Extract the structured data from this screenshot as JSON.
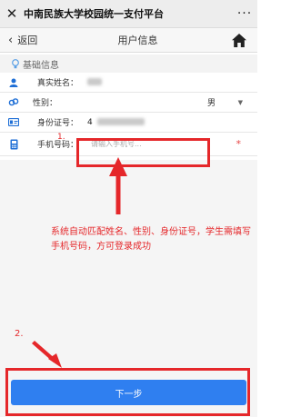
{
  "titlebar": {
    "close_icon": "close-x-icon",
    "title": "中南民族大学校园统一支付平台",
    "more_icon": "more-dots-icon",
    "more": "···"
  },
  "navbar": {
    "back_label": "返回",
    "title": "用户信息",
    "home_icon": "home-icon"
  },
  "section": {
    "title": "基础信息",
    "icon": "lightbulb-icon"
  },
  "form": {
    "name": {
      "label": "真实姓名：",
      "icon": "user-icon"
    },
    "gender": {
      "label": "性别：",
      "value": "男",
      "icon": "gender-icon"
    },
    "id_number": {
      "label": "身份证号：",
      "value_prefix": "4",
      "icon": "id-card-icon"
    },
    "phone": {
      "label": "手机号码：",
      "placeholder": "请输入手机号...",
      "required_mark": "*",
      "icon": "phone-icon"
    }
  },
  "annotations": {
    "step1": "1.",
    "note": "系统自动匹配姓名、性别、身份证号，学生需填写手机号码，方可登录成功",
    "step2": "2."
  },
  "next_button": {
    "label": "下一步"
  },
  "colors": {
    "primary": "#2f7ff0",
    "annotation": "#e5272a",
    "icon": "#1f6fd6"
  }
}
